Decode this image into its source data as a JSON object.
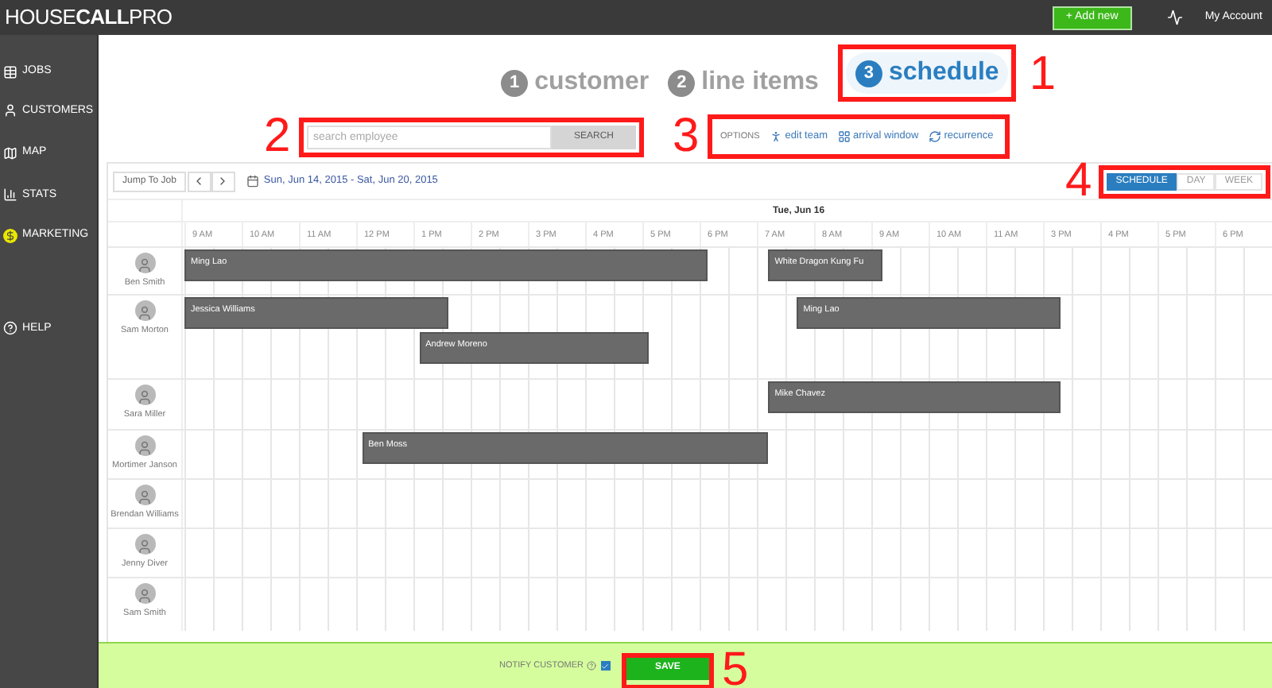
{
  "header": {
    "logo": "HOUSE**CALL**PRO",
    "add_button": "+ Add new",
    "account": "My Account"
  },
  "sidebar": {
    "items": [
      {
        "label": "JOBS"
      },
      {
        "label": "CUSTOMERS"
      },
      {
        "label": "MAP"
      },
      {
        "label": "STATS"
      },
      {
        "label": "MARKETING"
      },
      {
        "label": "HELP"
      }
    ]
  },
  "steps": {
    "annotation": "1",
    "items": [
      {
        "number": "1",
        "label": "customer",
        "selected": false
      },
      {
        "number": "2",
        "label": "line items",
        "selected": false
      },
      {
        "number": "3",
        "label": "schedule",
        "selected": true
      }
    ]
  },
  "search": {
    "annotation": "2",
    "placeholder": "search employee",
    "button": "SEARCH"
  },
  "options": {
    "annotation": "3",
    "label": "OPTIONS",
    "items": [
      "edit team",
      "arrival window",
      "recurrence"
    ]
  },
  "toolbar": {
    "jump_button": "Jump To Job",
    "date_range": "Sun, Jun 14, 2015 - Sat, Jun 20, 2015"
  },
  "views": {
    "annotation": "4",
    "items": [
      {
        "label": "SCHEDULE",
        "selected": true
      },
      {
        "label": "DAY",
        "selected": false
      },
      {
        "label": "WEEK",
        "selected": false
      }
    ]
  },
  "day_header": "Tue, Jun 16",
  "hours": [
    "9 AM",
    "10 AM",
    "11 AM",
    "12 PM",
    "1 PM",
    "2 PM",
    "3 PM",
    "4 PM",
    "5 PM",
    "6 PM",
    "7 AM",
    "8 AM",
    "9 AM",
    "10 AM",
    "11 AM",
    "3 PM",
    "4 PM",
    "5 PM",
    "6 PM"
  ],
  "employees": [
    {
      "name": "Ben Smith",
      "jobs": [
        "Ming Lao",
        "White Dragon Kung Fu"
      ]
    },
    {
      "name": "Sam Morton",
      "jobs": [
        "Jessica Williams",
        "Andrew Moreno",
        "Ming Lao"
      ]
    },
    {
      "name": "Sara Miller",
      "jobs": [
        "Mike Chavez"
      ]
    },
    {
      "name": "Mortimer Janson",
      "jobs": [
        "Ben Moss"
      ]
    },
    {
      "name": "Brendan Williams"
    },
    {
      "name": "Jenny Diver"
    },
    {
      "name": "Sam Smith"
    }
  ],
  "footer": {
    "notify_label": "NOTIFY CUSTOMER",
    "notify_checked": true,
    "save_button": "SAVE",
    "annotation": "5"
  }
}
